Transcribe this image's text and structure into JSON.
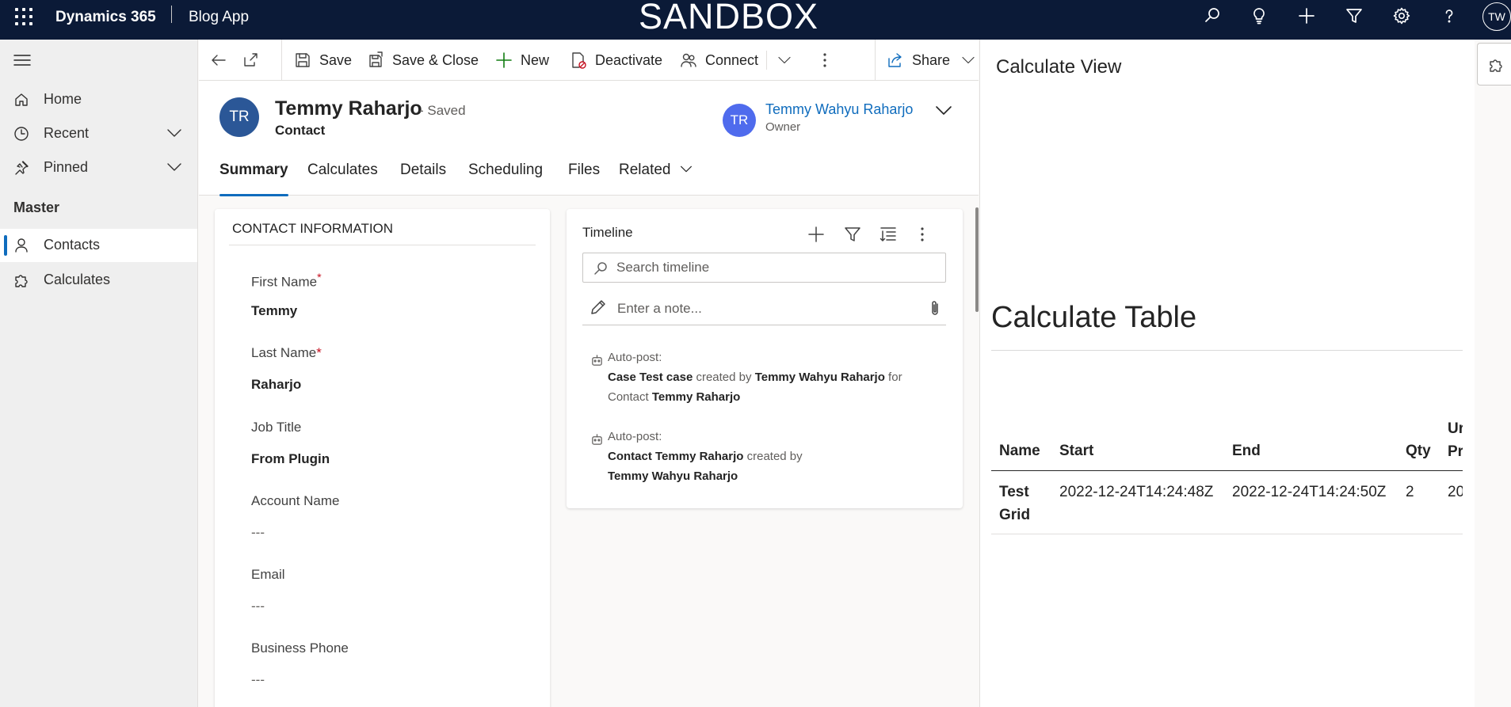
{
  "topbar": {
    "app_name": "Dynamics 365",
    "app_sub": "Blog App",
    "environment": "SANDBOX",
    "user_initials": "TW"
  },
  "leftnav": {
    "items": [
      {
        "label": "Home",
        "icon": "home-icon"
      },
      {
        "label": "Recent",
        "icon": "clock-icon"
      },
      {
        "label": "Pinned",
        "icon": "pin-icon"
      }
    ],
    "group": "Master",
    "entities": [
      {
        "label": "Contacts",
        "icon": "person-icon",
        "active": true
      },
      {
        "label": "Calculates",
        "icon": "puzzle-icon",
        "active": false
      }
    ]
  },
  "commands": {
    "save": "Save",
    "save_close": "Save & Close",
    "new": "New",
    "deactivate": "Deactivate",
    "connect": "Connect",
    "share": "Share"
  },
  "record": {
    "initials": "TR",
    "name": "Temmy Raharjo",
    "status": "- Saved",
    "type": "Contact",
    "owner_initials": "TR",
    "owner_name": "Temmy Wahyu Raharjo",
    "owner_label": "Owner"
  },
  "tabs": [
    "Summary",
    "Calculates",
    "Details",
    "Scheduling",
    "Files",
    "Related"
  ],
  "contact_info": {
    "title": "CONTACT INFORMATION",
    "fields": [
      {
        "label": "First Name",
        "req": "*",
        "value": "Temmy"
      },
      {
        "label": "Last Name",
        "req": "*",
        "value": "Raharjo"
      },
      {
        "label": "Job Title",
        "req": "",
        "value": "From Plugin"
      },
      {
        "label": "Account Name",
        "req": "",
        "value": "---"
      },
      {
        "label": "Email",
        "req": "",
        "value": "---"
      },
      {
        "label": "Business Phone",
        "req": "",
        "value": "---"
      }
    ]
  },
  "timeline": {
    "title": "Timeline",
    "search_placeholder": "Search timeline",
    "note_placeholder": "Enter a note...",
    "posts": [
      {
        "header": "Auto-post:",
        "subject": "Case Test case",
        "verb": " created by ",
        "actor": "Temmy Wahyu Raharjo",
        "prep": " for",
        "line2_pre": "Contact ",
        "line2_bold": "Temmy Raharjo"
      },
      {
        "header": "Auto-post:",
        "subject": "Contact Temmy Raharjo",
        "verb": " created by",
        "actor": "Temmy Wahyu Raharjo"
      }
    ]
  },
  "right_panel": {
    "title": "Calculate View",
    "heading": "Calculate Table",
    "columns": [
      "Name",
      "Start",
      "End",
      "Qty",
      "Ur",
      "Pr"
    ],
    "rows": [
      {
        "name_line1": "Test",
        "name_line2": "Grid",
        "start": "2022-12-24T14:24:48Z",
        "end": "2022-12-24T14:24:50Z",
        "qty": "2",
        "price": "20"
      }
    ]
  },
  "colors": {
    "topbar": "#0b1a37",
    "accent": "#0f6cbd",
    "avatar_record": "#2b5797",
    "avatar_owner": "#4f6bed",
    "required": "#c50f1f"
  }
}
